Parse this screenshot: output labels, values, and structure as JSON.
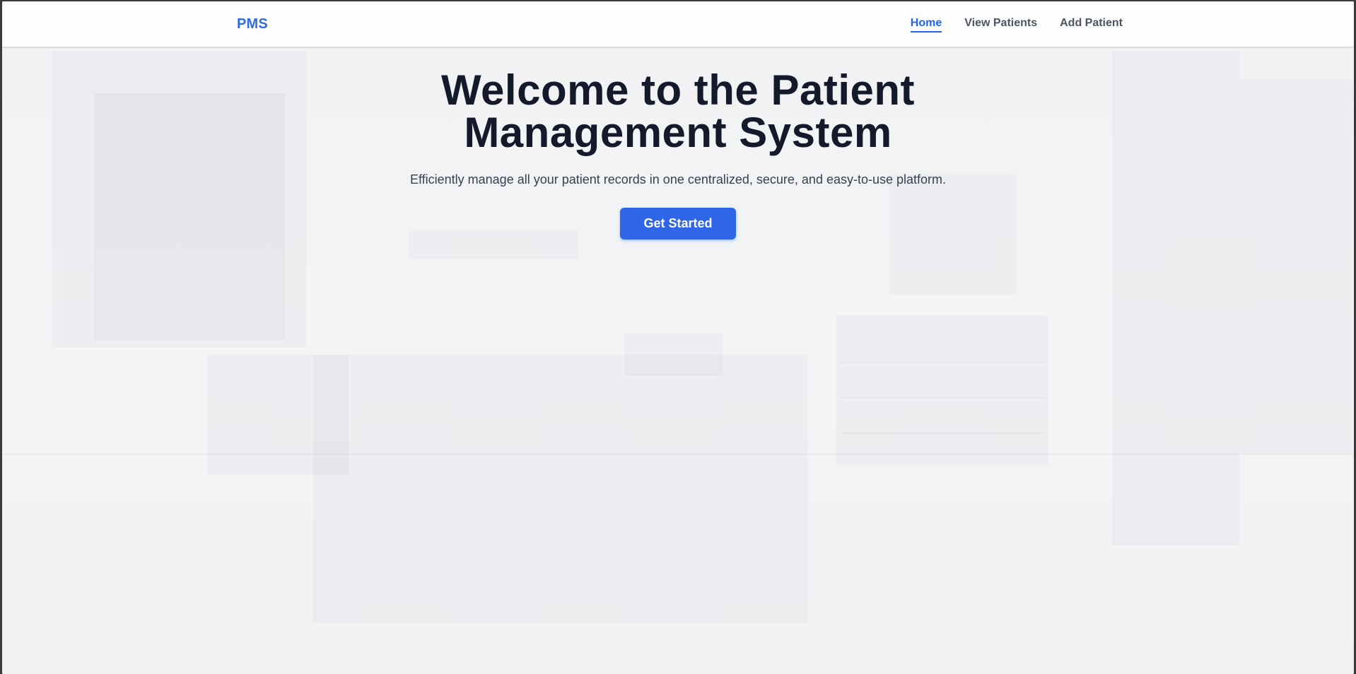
{
  "navbar": {
    "brand": "PMS",
    "links": [
      {
        "label": "Home",
        "active": true
      },
      {
        "label": "View Patients",
        "active": false
      },
      {
        "label": "Add Patient",
        "active": false
      }
    ]
  },
  "hero": {
    "title_line1": "Welcome to the Patient",
    "title_line2": "Management System",
    "subtitle": "Efficiently manage all your patient records in one centralized, secure, and easy-to-use platform.",
    "cta_label": "Get Started"
  },
  "colors": {
    "accent": "#2563eb",
    "button": "#2f66e8",
    "title": "#141a2b",
    "page_bg": "#f3f4f6"
  }
}
